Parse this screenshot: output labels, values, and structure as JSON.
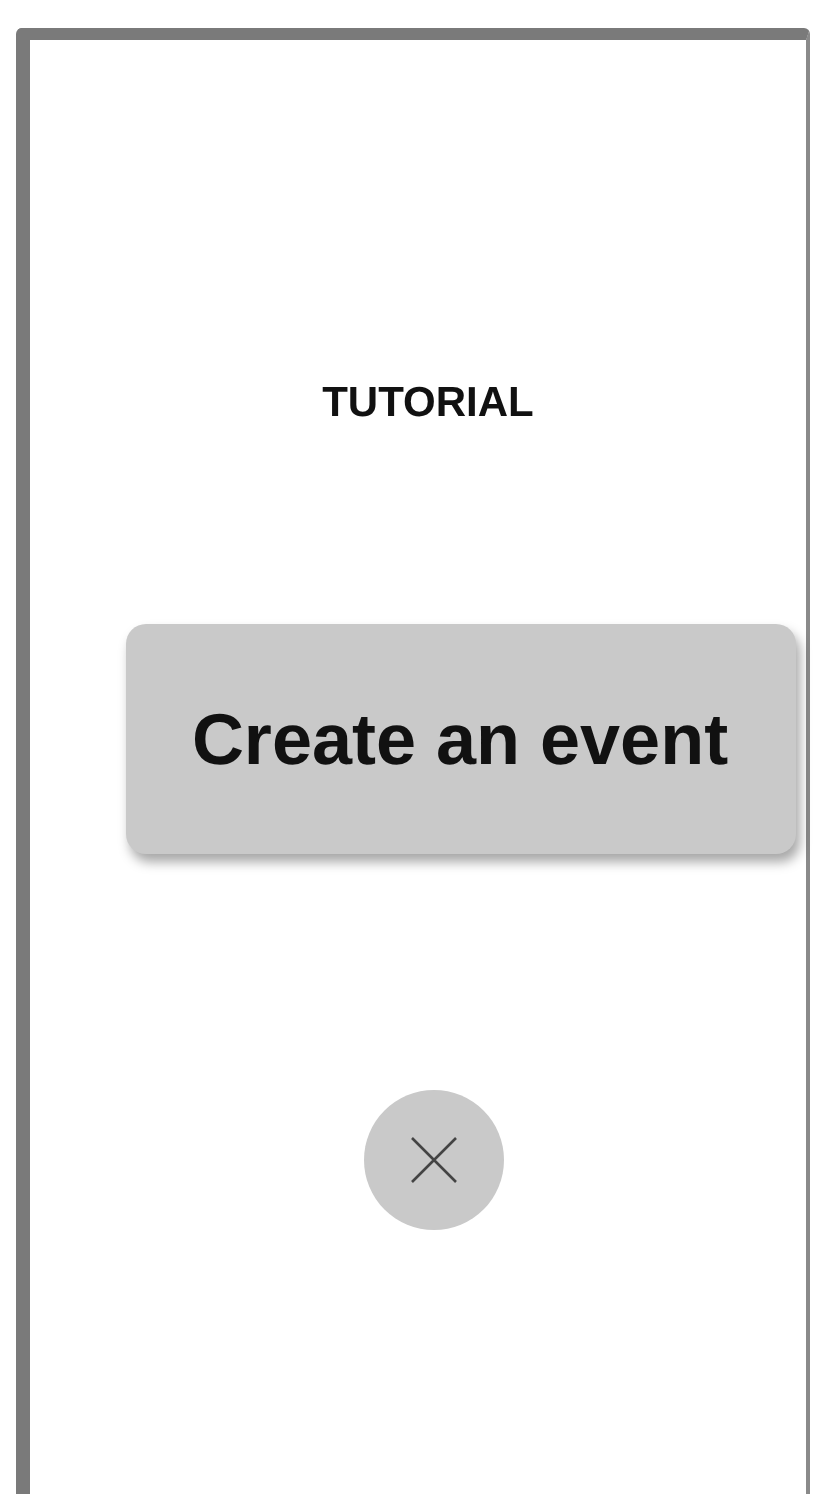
{
  "title": "TUTORIAL",
  "action_button": {
    "label": "Create an event"
  },
  "close_button": {
    "kind": "circle"
  }
}
